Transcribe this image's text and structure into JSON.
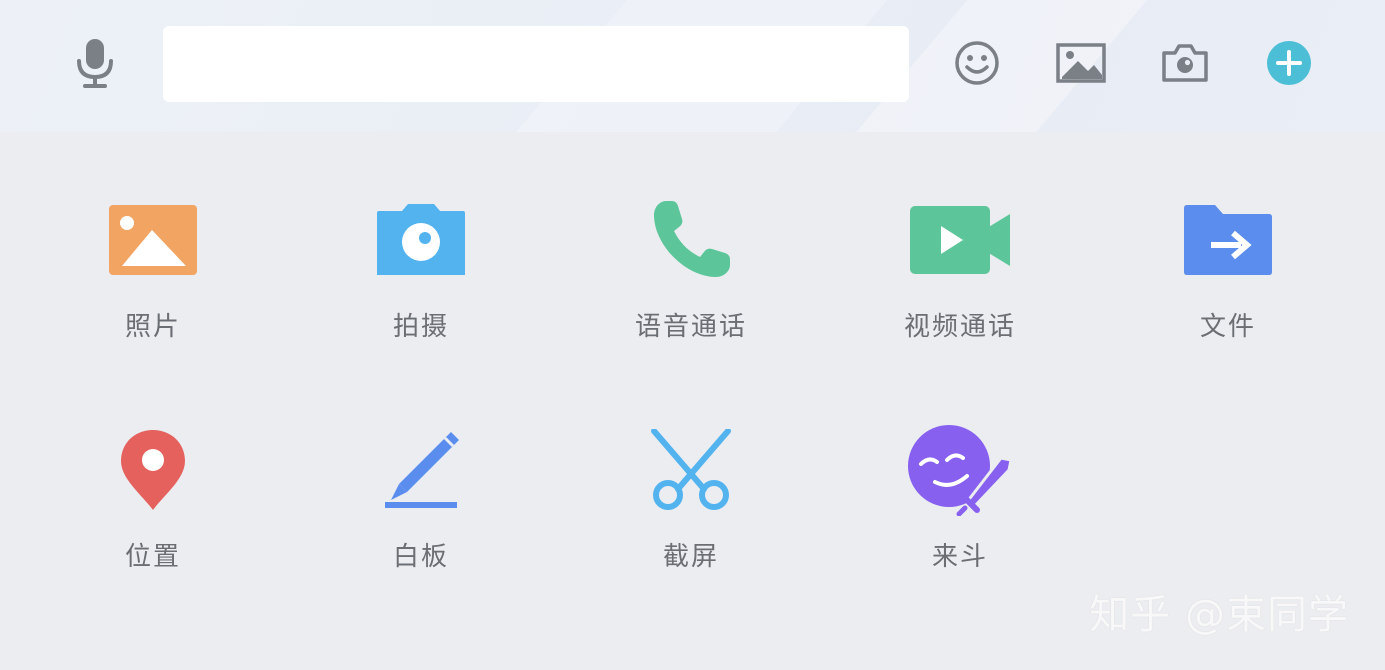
{
  "input_bar": {
    "voice_icon": "microphone-icon",
    "message_input": {
      "value": "",
      "placeholder": ""
    },
    "icons": [
      "emoji-icon",
      "image-icon",
      "camera-icon",
      "plus-icon"
    ],
    "accent_color": "#4cbfd6"
  },
  "actions": {
    "photo": {
      "label": "照片",
      "icon": "photo-icon",
      "color": "#f2a563"
    },
    "shoot": {
      "label": "拍摄",
      "icon": "camera-icon",
      "color": "#52b3ef"
    },
    "voice_call": {
      "label": "语音通话",
      "icon": "phone-icon",
      "color": "#5cc69a"
    },
    "video_call": {
      "label": "视频通话",
      "icon": "video-camera-icon",
      "color": "#5cc69a"
    },
    "file": {
      "label": "文件",
      "icon": "folder-icon",
      "color": "#5b8def"
    },
    "location": {
      "label": "位置",
      "icon": "location-pin-icon",
      "color": "#e5615e"
    },
    "whiteboard": {
      "label": "白板",
      "icon": "pencil-icon",
      "color": "#5b8def"
    },
    "screenshot": {
      "label": "截屏",
      "icon": "scissors-icon",
      "color": "#52b3ef"
    },
    "laidou": {
      "label": "来斗",
      "icon": "game-face-sword-icon",
      "color": "#8760ef"
    }
  },
  "watermark": "知乎 @束同学"
}
